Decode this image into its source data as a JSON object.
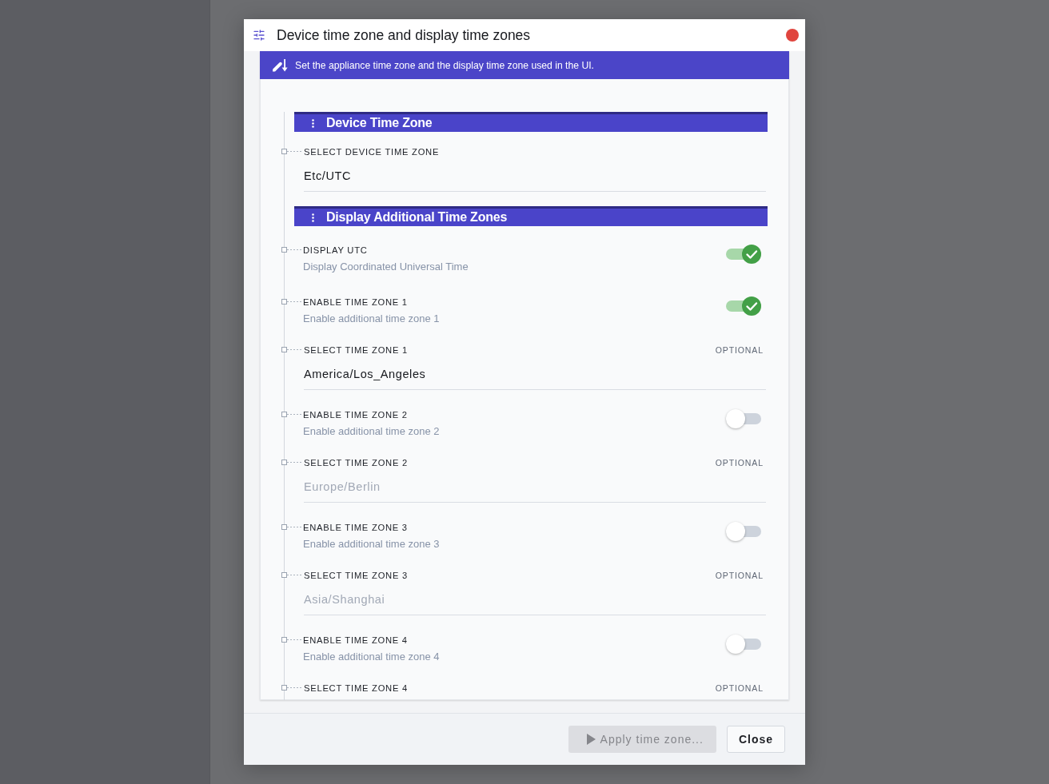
{
  "dialog": {
    "title": "Device time zone and display time zones",
    "banner": "Set the appliance time zone and the display time zone used in the UI."
  },
  "sections": [
    {
      "title": "Device Time Zone",
      "fields": [
        {
          "kind": "select",
          "label": "SELECT DEVICE TIME ZONE",
          "value": "Etc/UTC",
          "disabled": false
        }
      ]
    },
    {
      "title": "Display Additional Time Zones",
      "fields": [
        {
          "kind": "toggle",
          "label": "DISPLAY UTC",
          "description": "Display Coordinated Universal Time",
          "on": true
        },
        {
          "kind": "toggle",
          "label": "ENABLE TIME ZONE 1",
          "description": "Enable additional time zone 1",
          "on": true
        },
        {
          "kind": "select",
          "label": "SELECT TIME ZONE 1",
          "badge": "OPTIONAL",
          "value": "America/Los_Angeles",
          "disabled": false
        },
        {
          "kind": "toggle",
          "label": "ENABLE TIME ZONE 2",
          "description": "Enable additional time zone 2",
          "on": false
        },
        {
          "kind": "select",
          "label": "SELECT TIME ZONE 2",
          "badge": "OPTIONAL",
          "value": "Europe/Berlin",
          "disabled": true
        },
        {
          "kind": "toggle",
          "label": "ENABLE TIME ZONE 3",
          "description": "Enable additional time zone 3",
          "on": false
        },
        {
          "kind": "select",
          "label": "SELECT TIME ZONE 3",
          "badge": "OPTIONAL",
          "value": "Asia/Shanghai",
          "disabled": true
        },
        {
          "kind": "toggle",
          "label": "ENABLE TIME ZONE 4",
          "description": "Enable additional time zone 4",
          "on": false
        },
        {
          "kind": "select",
          "label": "SELECT TIME ZONE 4",
          "badge": "OPTIONAL"
        }
      ]
    }
  ],
  "footer": {
    "buttons": [
      {
        "kind": "primary",
        "label": "Apply time zone...",
        "disabled": true
      },
      {
        "kind": "secondary",
        "label": "Close",
        "disabled": false
      }
    ]
  }
}
